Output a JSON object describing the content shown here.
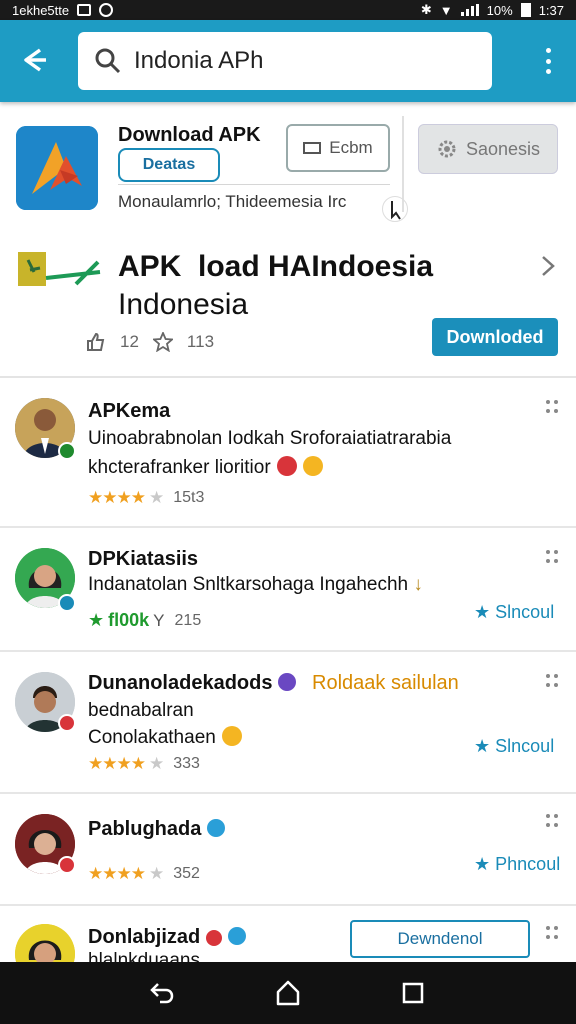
{
  "status_bar": {
    "left_text": "1ekhe5tte",
    "battery": "10%",
    "time": "1:37"
  },
  "search": {
    "value": "Indonia APh",
    "placeholder": ""
  },
  "featured": {
    "title": "Download APK",
    "tag_button": "Deatas",
    "echo_button": "Ecbm",
    "settings_button": "Saonesis",
    "subtitle": "Monaulamrlo; Thideemesia  Irc",
    "headline_line1": "APK  load HAIndoesia",
    "headline_line2": "Indonesia",
    "likes": "12",
    "stars": "113",
    "download_button": "Downloded"
  },
  "list": [
    {
      "name": "APKema",
      "line1": "Uinoabrabnolan Iodkah Sroforaiatiatrarabia",
      "line2": "khcterafranker lioritior",
      "rating": 3.5,
      "count": "15t3"
    },
    {
      "name": "DPKiatasiis",
      "line1": "Indanatolan Snltkarsohaga Ingahechh",
      "green_label": "fl00k",
      "green_suffix": "Y",
      "count": "215",
      "side_link": "Slncoul"
    },
    {
      "name": "Dunanoladekadods",
      "highlight": "Roldaak sailulan",
      "line1": "bednabalran",
      "line2": "Conolakathaen",
      "rating": 4,
      "count": "333",
      "side_link": "Slncoul"
    },
    {
      "name": "Pablughada",
      "rating": 3.5,
      "count": "352",
      "side_link": "Phncoul"
    },
    {
      "name": "Donlabjizad",
      "line1": "hlalnkduaans",
      "download_button": "Dewndenol"
    }
  ],
  "colors": {
    "accent": "#1e9cc4",
    "button": "#1b8fbb",
    "star": "#f0a020",
    "green": "#1f9a2e",
    "highlight": "#d88a00"
  },
  "icons": [
    "back-icon",
    "search-icon",
    "more-vert-icon",
    "gear-icon",
    "chevron-right-icon",
    "thumb-up-icon",
    "star-icon",
    "drag-handle-icon",
    "nav-back-icon",
    "nav-home-icon",
    "nav-recents-icon"
  ]
}
